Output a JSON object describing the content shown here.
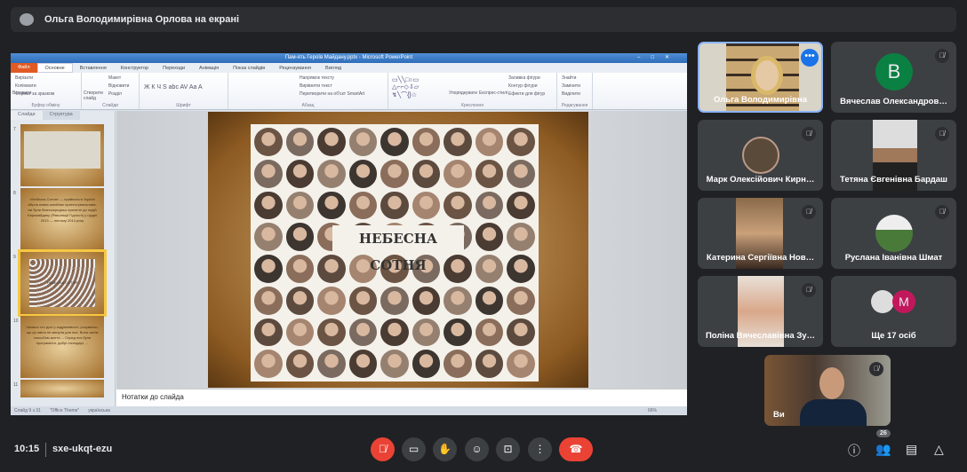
{
  "presenting_banner": "Ольга Володимирівна Орлова на екрані",
  "powerpoint": {
    "window_title": "Пам-ять Героїв Майдану.pptx - Microsoft PowerPoint",
    "tabs": [
      "Файл",
      "Основне",
      "Вставлення",
      "Конструктор",
      "Переходи",
      "Анімація",
      "Показ слайдів",
      "Рецензування",
      "Вигляд"
    ],
    "ribbon": {
      "clipboard": {
        "paste": "Вставити",
        "cut": "Вирізати",
        "copy": "Копіювати",
        "format": "Формат за зразком",
        "label": "Буфер обміну"
      },
      "slides": {
        "new": "Створити слайд",
        "layout": "Макет",
        "reset": "Відновити",
        "section": "Розділ",
        "label": "Слайди"
      },
      "font": {
        "label": "Шрифт"
      },
      "paragraph": {
        "dir": "Напрямок тексту",
        "align": "Вирівняти текст",
        "smartart": "Перетворити на об'єкт SmartArt",
        "label": "Абзац"
      },
      "drawing": {
        "arrange": "Упорядкувати",
        "quick": "Експрес-стилі",
        "fill": "Заливка фігури",
        "outline": "Контур фігури",
        "effects": "Ефекти для фігур",
        "label": "Креслення"
      },
      "editing": {
        "find": "Знайти",
        "replace": "Замінити",
        "select": "Виділити",
        "label": "Редагування"
      }
    },
    "pane_tabs": [
      "Слайди",
      "Структура"
    ],
    "thumbnails": [
      {
        "num": "7",
        "text": ""
      },
      {
        "num": "8",
        "text": "«Небесна Сотня» — прийнята в Україні збірна назва загиблих протестувальників, які були безпосередньо причетні до подій Євромайдану (Революції Гідності) у грудні 2013 — лютому 2014 року"
      },
      {
        "num": "9",
        "text": "НЕБЕСНА СОТНЯ"
      },
      {
        "num": "10",
        "text": "Чимало хто досі у задумливості, розуміючи, що ця зміна не минула для них. Вони своїм способом життя ... Серед них були програмісти, добрі господарі, ..."
      },
      {
        "num": "11",
        "text": ""
      }
    ],
    "slide_title": "НЕБЕСНА СОТНЯ",
    "notes_placeholder": "Нотатки до слайда",
    "status": {
      "slide": "Слайд 9 з 31",
      "theme": "\"Office Theme\"",
      "lang": "українська",
      "zoom": "66%"
    }
  },
  "participants": [
    {
      "name": "Ольга Володимирівна",
      "type": "video",
      "active": true
    },
    {
      "name": "Вячеслав Олександров…",
      "initial": "B",
      "color": "#0b8043",
      "muted": true
    },
    {
      "name": "Марк Олексійович Кирн…",
      "muted": true
    },
    {
      "name": "Тетяна Євгенівна Бардаш",
      "muted": true
    },
    {
      "name": "Катерина Сергіївна Нов…",
      "muted": true
    },
    {
      "name": "Руслана Іванівна Шмат",
      "muted": true
    },
    {
      "name": "Поліна Вячеславівна Зу…",
      "muted": true
    },
    {
      "name": "Ще 17 осіб",
      "initial": "M",
      "color": "#c2185b"
    }
  ],
  "self_view": {
    "name": "Ви",
    "muted": true
  },
  "bottom": {
    "time": "10:15",
    "meeting_code": "sxe-ukqt-ezu",
    "participant_count": "26"
  },
  "colors": {
    "background": "#202124",
    "tile": "#3c4043",
    "danger": "#ea4335",
    "accent": "#8ab4f8"
  }
}
